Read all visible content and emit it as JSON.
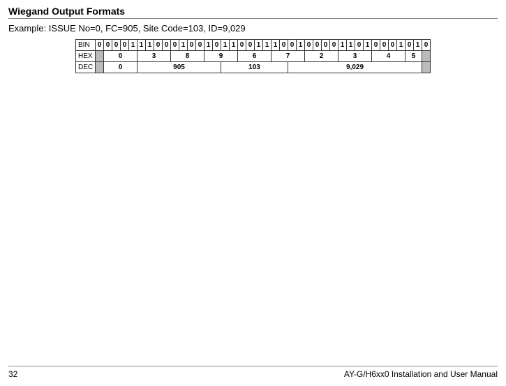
{
  "header": {
    "title": "Wiegand Output Formats"
  },
  "example": "Example: ISSUE No=0, FC=905, Site Code=103, ID=9,029",
  "table": {
    "row_labels": {
      "bin": "BIN",
      "hex": "HEX",
      "dec": "DEC"
    },
    "bin": [
      "0",
      "0",
      "0",
      "0",
      "1",
      "1",
      "1",
      "0",
      "0",
      "0",
      "1",
      "0",
      "0",
      "1",
      "0",
      "1",
      "1",
      "0",
      "0",
      "1",
      "1",
      "1",
      "0",
      "0",
      "1",
      "0",
      "0",
      "0",
      "0",
      "1",
      "1",
      "0",
      "1",
      "0",
      "0",
      "0",
      "1",
      "0",
      "1",
      "0"
    ],
    "hex": [
      "0",
      "3",
      "8",
      "9",
      "6",
      "7",
      "2",
      "3",
      "4",
      "5"
    ],
    "dec": [
      "0",
      "905",
      "103",
      "9,029"
    ]
  },
  "footer": {
    "page": "32",
    "manual": "AY-G/H6xx0 Installation and User Manual"
  },
  "chart_data": {
    "type": "table",
    "title": "Wiegand Output Formats Example",
    "rows": [
      {
        "label": "BIN",
        "values": [
          "0",
          "0",
          "0",
          "0",
          "1",
          "1",
          "1",
          "0",
          "0",
          "0",
          "1",
          "0",
          "0",
          "1",
          "0",
          "1",
          "1",
          "0",
          "0",
          "1",
          "1",
          "1",
          "0",
          "0",
          "1",
          "0",
          "0",
          "0",
          "0",
          "1",
          "1",
          "0",
          "1",
          "0",
          "0",
          "0",
          "1",
          "0",
          "1",
          "0"
        ]
      },
      {
        "label": "HEX",
        "values": [
          "0",
          "3",
          "8",
          "9",
          "6",
          "7",
          "2",
          "3",
          "4",
          "5"
        ]
      },
      {
        "label": "DEC",
        "values": [
          "0",
          "905",
          "103",
          "9,029"
        ]
      }
    ]
  }
}
